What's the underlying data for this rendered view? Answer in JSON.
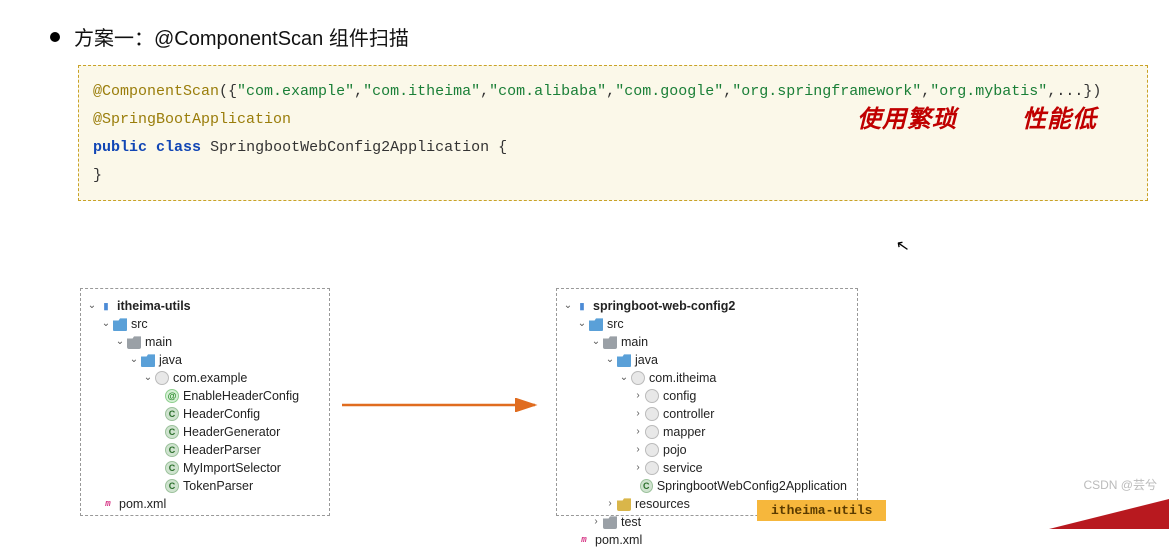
{
  "bullet": {
    "text": "方案一：@ComponentScan 组件扫描"
  },
  "code": {
    "ann1": "@ComponentScan",
    "paren_open": "({",
    "strs": [
      "\"com.example\"",
      "\"com.itheima\"",
      "\"com.alibaba\"",
      "\"com.google\"",
      "\"org.springframework\"",
      "\"org.mybatis\""
    ],
    "comma": ",",
    "ellipsis": ",...})",
    "ann2": "@SpringBootApplication",
    "kw_public": "public",
    "kw_class": "class",
    "cls_name": "SpringbootWebConfig2Application {",
    "close": "}"
  },
  "notes": {
    "a": "使用繁琐",
    "b": "性能低"
  },
  "tree_left": {
    "root": "itheima-utils",
    "nodes": {
      "src": "src",
      "main": "main",
      "java": "java",
      "pkg": "com.example",
      "f1": "EnableHeaderConfig",
      "f2": "HeaderConfig",
      "f3": "HeaderGenerator",
      "f4": "HeaderParser",
      "f5": "MyImportSelector",
      "f6": "TokenParser",
      "pom": "pom.xml"
    }
  },
  "tree_right": {
    "root": "springboot-web-config2",
    "nodes": {
      "src": "src",
      "main": "main",
      "java": "java",
      "pkg": "com.itheima",
      "d1": "config",
      "d2": "controller",
      "d3": "mapper",
      "d4": "pojo",
      "d5": "service",
      "app": "SpringbootWebConfig2Application",
      "res": "resources",
      "test": "test",
      "pom": "pom.xml"
    }
  },
  "tag": {
    "label": "itheima-utils"
  },
  "watermark": "CSDN @芸兮"
}
